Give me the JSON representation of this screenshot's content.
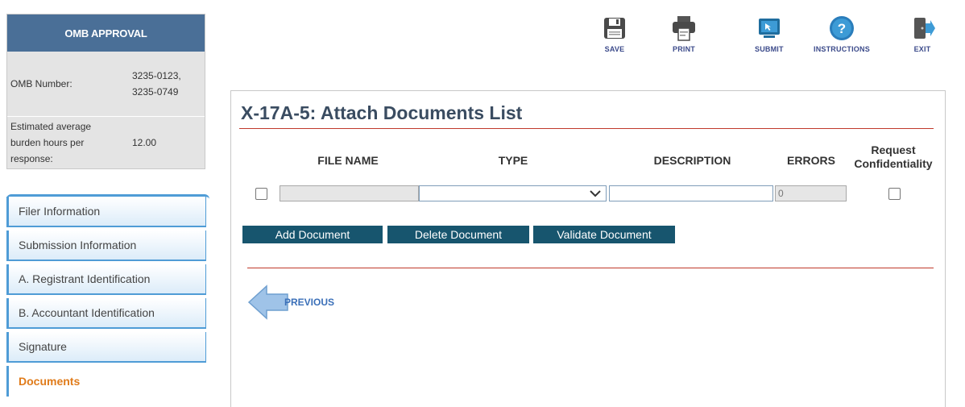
{
  "omb": {
    "header": "OMB APPROVAL",
    "number_label": "OMB Number:",
    "number_line1": "3235-0123,",
    "number_line2": "3235-0749",
    "burden_line1": "Estimated average",
    "burden_line2": "burden hours per",
    "burden_line3": "response:",
    "burden_value": "12.00"
  },
  "nav": {
    "items": [
      {
        "label": "Filer Information"
      },
      {
        "label": "Submission Information"
      },
      {
        "label": "A. Registrant Identification"
      },
      {
        "label": "B. Accountant Identification"
      },
      {
        "label": "Signature"
      },
      {
        "label": "Documents"
      }
    ],
    "active_index": 5
  },
  "toolbar": {
    "save": "SAVE",
    "print": "PRINT",
    "submit": "SUBMIT",
    "instructions": "INSTRUCTIONS",
    "exit": "EXIT"
  },
  "page": {
    "title": "X-17A-5: Attach Documents List"
  },
  "table": {
    "headers": {
      "file_name": "FILE NAME",
      "type": "TYPE",
      "description": "DESCRIPTION",
      "errors": "ERRORS",
      "confidentiality_line1": "Request",
      "confidentiality_line2": "Confidentiality"
    },
    "row": {
      "file_name": "",
      "type": "",
      "description": "",
      "errors": "0"
    }
  },
  "buttons": {
    "add": "Add Document",
    "delete": "Delete Document",
    "validate": "Validate Document"
  },
  "previous_label": "PREVIOUS",
  "colors": {
    "omb_header": "#4a6f97",
    "nav_border": "#4f9cd6",
    "active_nav": "#e07b1a",
    "button": "#17556e",
    "rule": "#c0392b"
  }
}
